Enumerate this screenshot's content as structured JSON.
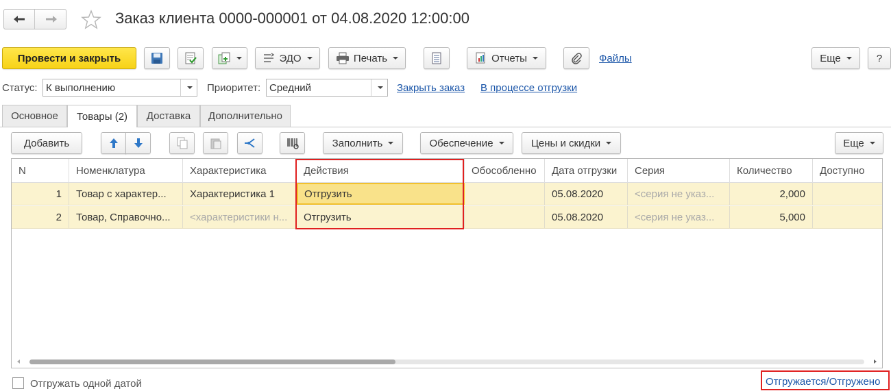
{
  "window": {
    "title": "Заказ клиента 0000-000001 от 04.08.2020 12:00:00"
  },
  "toolbar": {
    "post_and_close": "Провести и закрыть",
    "edo": "ЭДО",
    "print": "Печать",
    "reports": "Отчеты",
    "files": "Файлы",
    "more": "Еще",
    "help": "?"
  },
  "status_row": {
    "status_label": "Статус:",
    "status_value": "К выполнению",
    "priority_label": "Приоритет:",
    "priority_value": "Средний",
    "close_order": "Закрыть заказ",
    "shipping_in_progress": "В процессе отгрузки"
  },
  "tabs": [
    {
      "label": "Основное",
      "active": false
    },
    {
      "label": "Товары (2)",
      "active": true
    },
    {
      "label": "Доставка",
      "active": false
    },
    {
      "label": "Дополнительно",
      "active": false
    }
  ],
  "grid_toolbar": {
    "add": "Добавить",
    "fill": "Заполнить",
    "provision": "Обеспечение",
    "prices": "Цены и скидки",
    "more": "Еще"
  },
  "table": {
    "columns": [
      "N",
      "Номенклатура",
      "Характеристика",
      "Действия",
      "Обособленно",
      "Дата отгрузки",
      "Серия",
      "Количество",
      "Доступно"
    ],
    "rows": [
      {
        "n": "1",
        "item": "Товар с характер...",
        "characteristic": "Характеристика 1",
        "action": "Отгрузить",
        "separate": "",
        "date": "05.08.2020",
        "series": "<серия не указ...",
        "qty": "2,000",
        "available": ""
      },
      {
        "n": "2",
        "item": "Товар, Справочно...",
        "characteristic": "<характеристики н...",
        "action": "Отгрузить",
        "separate": "",
        "date": "05.08.2020",
        "series": "<серия не указ...",
        "qty": "5,000",
        "available": ""
      }
    ]
  },
  "footer": {
    "ship_one_date": "Отгружать одной датой",
    "shipping_status": "Отгружается/Отгружено"
  },
  "colors": {
    "accent_yellow": "#f7d217",
    "row_bg": "#fbf3cf",
    "selected_cell": "#f9e28a",
    "highlight_red": "#e02020",
    "link_blue": "#1a55a8"
  }
}
